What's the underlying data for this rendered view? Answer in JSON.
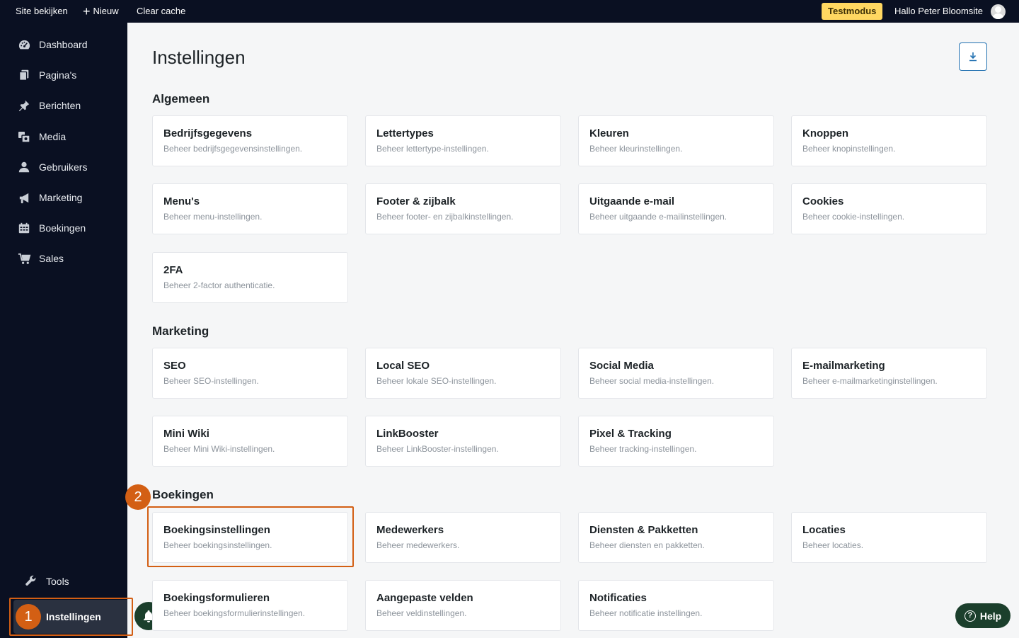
{
  "topbar": {
    "site_view": "Site bekijken",
    "new": "Nieuw",
    "clear_cache": "Clear cache",
    "test_mode": "Testmodus",
    "greeting": "Hallo Peter Bloomsite"
  },
  "sidebar": {
    "items": [
      {
        "label": "Dashboard",
        "icon": "gauge-icon"
      },
      {
        "label": "Pagina's",
        "icon": "pages-icon"
      },
      {
        "label": "Berichten",
        "icon": "pin-icon"
      },
      {
        "label": "Media",
        "icon": "media-icon"
      },
      {
        "label": "Gebruikers",
        "icon": "user-icon"
      },
      {
        "label": "Marketing",
        "icon": "megaphone-icon"
      },
      {
        "label": "Boekingen",
        "icon": "calendar-icon"
      },
      {
        "label": "Sales",
        "icon": "cart-icon"
      }
    ],
    "tools": "Tools",
    "settings": "Instellingen"
  },
  "callouts": {
    "one": "1",
    "two": "2"
  },
  "page": {
    "title": "Instellingen"
  },
  "sections": {
    "general": {
      "title": "Algemeen",
      "cards": [
        {
          "title": "Bedrijfsgegevens",
          "desc": "Beheer bedrijfsgegevensinstellingen."
        },
        {
          "title": "Lettertypes",
          "desc": "Beheer lettertype-instellingen."
        },
        {
          "title": "Kleuren",
          "desc": "Beheer kleurinstellingen."
        },
        {
          "title": "Knoppen",
          "desc": "Beheer knopinstellingen."
        },
        {
          "title": "Menu's",
          "desc": "Beheer menu-instellingen."
        },
        {
          "title": "Footer & zijbalk",
          "desc": "Beheer footer- en zijbalkinstellingen."
        },
        {
          "title": "Uitgaande e-mail",
          "desc": "Beheer uitgaande e-mailinstellingen."
        },
        {
          "title": "Cookies",
          "desc": "Beheer cookie-instellingen."
        },
        {
          "title": "2FA",
          "desc": "Beheer 2-factor authenticatie."
        }
      ]
    },
    "marketing": {
      "title": "Marketing",
      "cards": [
        {
          "title": "SEO",
          "desc": "Beheer SEO-instellingen."
        },
        {
          "title": "Local SEO",
          "desc": "Beheer lokale SEO-instellingen."
        },
        {
          "title": "Social Media",
          "desc": "Beheer social media-instellingen."
        },
        {
          "title": "E-mailmarketing",
          "desc": "Beheer e-mailmarketinginstellingen."
        },
        {
          "title": "Mini Wiki",
          "desc": "Beheer Mini Wiki-instellingen."
        },
        {
          "title": "LinkBooster",
          "desc": "Beheer LinkBooster-instellingen."
        },
        {
          "title": "Pixel & Tracking",
          "desc": "Beheer tracking-instellingen."
        }
      ]
    },
    "bookings": {
      "title": "Boekingen",
      "cards": [
        {
          "title": "Boekingsinstellingen",
          "desc": "Beheer boekingsinstellingen."
        },
        {
          "title": "Medewerkers",
          "desc": "Beheer medewerkers."
        },
        {
          "title": "Diensten & Pakketten",
          "desc": "Beheer diensten en pakketten."
        },
        {
          "title": "Locaties",
          "desc": "Beheer locaties."
        },
        {
          "title": "Boekingsformulieren",
          "desc": "Beheer boekingsformulierinstellingen."
        },
        {
          "title": "Aangepaste velden",
          "desc": "Beheer veldinstellingen."
        },
        {
          "title": "Notificaties",
          "desc": "Beheer notificatie instellingen."
        }
      ]
    }
  },
  "help": {
    "label": "Help"
  },
  "colors": {
    "sidebar_bg": "#0a1022",
    "accent": "#2271b1",
    "callout": "#d35f14",
    "test_mode_bg": "#ffd761",
    "help_bg": "#1b3f2c"
  }
}
